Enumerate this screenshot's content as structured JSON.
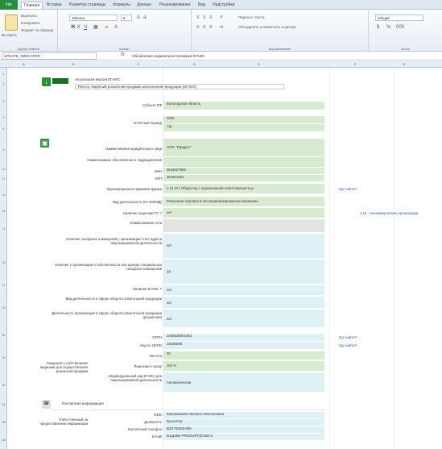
{
  "ribbon": {
    "file_tab": "File",
    "tabs": [
      "Главная",
      "Вставка",
      "Разметка страницы",
      "Формулы",
      "Данные",
      "Рецензирование",
      "Вид",
      "Надстройки"
    ],
    "clipboard_group": "Буфер обмена",
    "font_group": "Шрифт",
    "alignment_group": "Выравнивание",
    "number_group": "Число",
    "paste_label": "Вставить",
    "cut_label": "Вырезать",
    "copy_label": "Копировать",
    "format_painter_label": "Формат по образцу",
    "font_name": "Tahoma",
    "font_size": "8",
    "wrap_text_label": "Перенос текста",
    "merge_label": "Объединить и поместить в центре",
    "number_format": "Общий"
  },
  "formula_bar": {
    "name_box": "UPDATE_INDICATOR",
    "fx": "fx",
    "formula": "Обновление индикаторов проверки ЕГАИС"
  },
  "header": {
    "check_text": "Актуальная версия ЕГАИС",
    "subtitle": "Реестр лицензий розничной продажи алкогольной продукции (ЕГАИС)"
  },
  "rows": [
    {
      "label": "Субъект РФ",
      "value": "Вологодская область",
      "color": "g"
    },
    {
      "label": "Отчётный период",
      "value": "2020",
      "color": "g"
    },
    {
      "label": "",
      "value": "год",
      "color": "g"
    },
    {
      "label": "Наименование юридического лица",
      "value": "ООО \"Продукт\"",
      "color": "g"
    },
    {
      "label": "Наименование обособленного подразделения",
      "value": "",
      "color": "g"
    },
    {
      "label": "ИНН",
      "value": "3514027960",
      "color": "g"
    },
    {
      "label": "КПП",
      "value": "351401001",
      "color": "g"
    },
    {
      "label": "Организационно-правовая форма",
      "value": "1 12 47 / Общество с ограниченной ответственностью",
      "color": "g"
    },
    {
      "label": "Вид деятельности (по ОКВЭД)",
      "value": "Розничная торговля в неспециализированных магазинах",
      "color": "g"
    },
    {
      "label": "Наличие лицензии ТС ?",
      "value": "нет",
      "color": "g"
    },
    {
      "label": "Наименование сети",
      "value": "",
      "color": "gray"
    },
    {
      "label": "Наличие складских помещений у организации / Нет адреса лицензированной деятельности",
      "value": "нет",
      "color": "b"
    },
    {
      "label": "Наличие у организации в собственности или аренде специальных складских помещений",
      "value": "да",
      "color": "b"
    },
    {
      "label": "Наличие ЕГАИС ?",
      "value": "нет",
      "color": "b"
    },
    {
      "label": "Вид деятельности в сфере оборота алкогольной продукции",
      "value": "нет",
      "color": "b"
    },
    {
      "label": "Деятельность организации в сфере оборота алкогольной продукции (розничная)",
      "value": "нет",
      "color": "b"
    },
    {
      "label": "ОГРН",
      "value": "1083535001063",
      "color": "b"
    },
    {
      "label": "Код по ОКПО",
      "value": "19336056",
      "color": "b"
    },
    {
      "label": "Частота",
      "value": "30",
      "color": "g"
    },
    {
      "label": "Лицензии к сроку",
      "value": "100 %",
      "color": "g"
    },
    {
      "label": "Индивидуальный код ЕГАИС для лицензированной деятельности",
      "value": "Автоматически",
      "color": "b"
    }
  ],
  "side_links": {
    "check1": "Где найти?",
    "org_type": "1 12 - Некоммерческие организации",
    "check2": "Где найти?",
    "check3": "Где найти?"
  },
  "group_label": "Сведения о собственнике лицензии для осуществления розничной продажи",
  "contact": {
    "section_title": "Контактная информация",
    "left_label": "Ответственный за предоставление информации",
    "rows": [
      {
        "label": "ФИО",
        "value": "Калинникова Наталья Анатольевна"
      },
      {
        "label": "Должность",
        "value": "бухгалтер"
      },
      {
        "label": "Контактный телефон",
        "value": "8(81755)55-555"
      },
      {
        "label": "E-mail",
        "value": "buxgalter-PRODUKT@mail.ru"
      }
    ]
  }
}
